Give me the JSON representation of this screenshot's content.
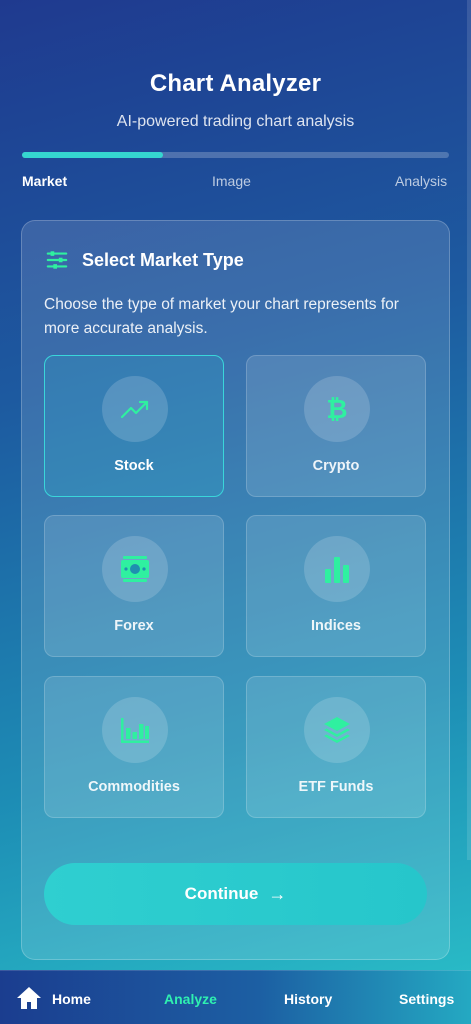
{
  "header": {
    "title": "Chart Analyzer",
    "subtitle": "AI-powered trading chart analysis"
  },
  "progress": {
    "fraction": 0.33,
    "steps": [
      "Market",
      "Image",
      "Analysis"
    ],
    "active_step": "Market"
  },
  "card": {
    "icon": "sliders-icon",
    "title": "Select Market Type",
    "description": "Choose the type of market your chart represents for more accurate analysis.",
    "options": [
      {
        "label": "Stock",
        "icon": "trending-up-icon",
        "selected": true
      },
      {
        "label": "Crypto",
        "icon": "bitcoin-icon",
        "selected": false
      },
      {
        "label": "Forex",
        "icon": "money-bill-icon",
        "selected": false
      },
      {
        "label": "Indices",
        "icon": "bar-chart-icon",
        "selected": false
      },
      {
        "label": "Commodities",
        "icon": "chart-bars-icon",
        "selected": false
      },
      {
        "label": "ETF Funds",
        "icon": "layers-icon",
        "selected": false
      }
    ],
    "continue_label": "Continue"
  },
  "nav": {
    "items": [
      {
        "label": "Home",
        "icon": "home-icon"
      },
      {
        "label": "Analyze"
      },
      {
        "label": "History"
      },
      {
        "label": "Settings"
      }
    ],
    "active": "Analyze"
  },
  "colors": {
    "accent": "#35d6d0",
    "icon_green": "#2ff0a0",
    "nav_active": "#2ff0b0"
  }
}
